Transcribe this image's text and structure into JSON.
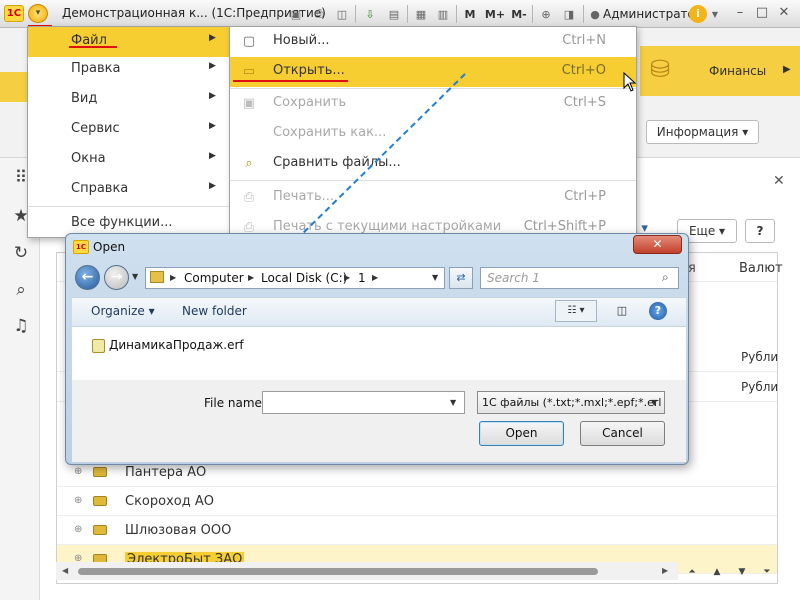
{
  "titlebar": {
    "app_title": "Демонстрационная к... (1С:Предприятие)",
    "user": "Администратор",
    "logo": "1С",
    "m_label": "M",
    "mplus_label": "M+",
    "mminus_label": "M-"
  },
  "main_menu": {
    "items": [
      {
        "label": "Файл",
        "has_submenu": true,
        "active": true
      },
      {
        "label": "Правка",
        "has_submenu": true
      },
      {
        "label": "Вид",
        "has_submenu": true
      },
      {
        "label": "Сервис",
        "has_submenu": true
      },
      {
        "label": "Окна",
        "has_submenu": true
      },
      {
        "label": "Справка",
        "has_submenu": true
      },
      {
        "label": "Все функции..."
      }
    ]
  },
  "file_submenu": {
    "items": [
      {
        "label": "Новый...",
        "shortcut": "Ctrl+N",
        "icon": "new-doc-icon"
      },
      {
        "label": "Открыть...",
        "shortcut": "Ctrl+O",
        "icon": "open-folder-icon",
        "active": true
      },
      {
        "label": "Сохранить",
        "shortcut": "Ctrl+S",
        "icon": "save-icon",
        "disabled": true
      },
      {
        "label": "Сохранить как...",
        "shortcut": "",
        "disabled": true
      },
      {
        "label": "Сравнить файлы...",
        "shortcut": "",
        "icon": "compare-files-icon"
      },
      {
        "label": "Печать...",
        "shortcut": "Ctrl+P",
        "icon": "print-icon",
        "disabled": true
      },
      {
        "label": "Печать с текущими настройками",
        "shortcut": "Ctrl+Shift+P",
        "icon": "print-icon",
        "disabled": true
      }
    ]
  },
  "background": {
    "section_label": "Финансы",
    "info_button": "Информация",
    "more_button": "Еще",
    "help_button": "?",
    "column_currency": "Валют",
    "rows": [
      {
        "name": "Пантера АО",
        "currency": ""
      },
      {
        "name": "Скороход АО",
        "currency": ""
      },
      {
        "name": "Шлюзовая ООО",
        "currency": ""
      },
      {
        "name": "ЭлектроБыт ЗАО",
        "currency": ""
      }
    ],
    "partial_currency_1": "Рубли",
    "partial_currency_2": "Рубли"
  },
  "open_dialog": {
    "title": "Open",
    "breadcrumbs": [
      "Computer",
      "Local Disk (C:)",
      "1"
    ],
    "search_placeholder": "Search 1",
    "organize": "Organize",
    "new_folder": "New folder",
    "file": "ДинамикаПродаж.erf",
    "file_name_label": "File name:",
    "file_name_value": "",
    "filter": "1С файлы (*.txt;*.mxl;*.epf;*.erl",
    "open_button": "Open",
    "cancel_button": "Cancel"
  },
  "colors": {
    "menu_highlight": "#f6ce31",
    "annotation_red": "#e01010",
    "arrow_blue": "#1f7ed6"
  }
}
